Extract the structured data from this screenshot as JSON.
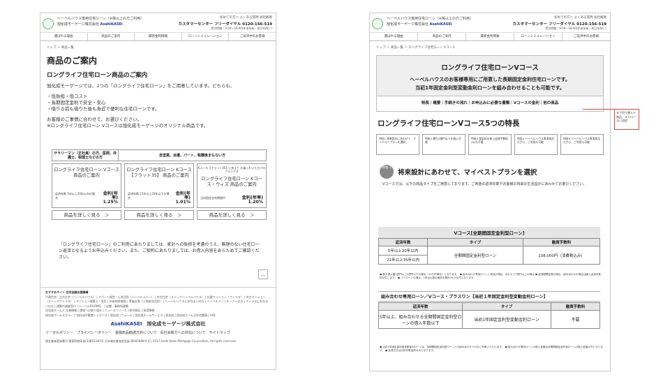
{
  "shared": {
    "org_line": "ヘーベルハウス専用住宅ローン（※株以上の方ご利用）",
    "company_name": "旭化成モーゲージ株式会社",
    "brand": "AsahiKASEI",
    "links": "初めての方へ  よくある質問    会社概要",
    "customer_center": "カスタマーセンター  フリーダイヤル 0120-156-519",
    "hours": "受付時間：9:00～18:00(年末年始・祝日を除く)"
  },
  "pageA": {
    "nav": [
      "選ばれる理由",
      "商品のご案内",
      "最新金利情報",
      "ローンシミュレーション",
      "ご返済中のお客様"
    ],
    "breadcrumb": "トップ ＞ 商品一覧",
    "title": "商品のご案内",
    "subtitle": "ロングライフ住宅ローン商品のご案内",
    "intro": "旭化成モーゲージでは、2つの「ロングライフ住宅ローン」をご用意しています。どちらも、",
    "bullets": [
      "・低負担・低コスト",
      "・長期固定金利で安全・安心",
      "・借りる前も借りた後も身近で便利な住宅ローンです。"
    ],
    "intro2": "お客様のご事情に合わせて、お選びください。",
    "intro3": "※ロングライフ住宅ローン Vコースは旭化成モーゲージのオリジナル商品です。",
    "segments": [
      "サラリーマン（正社員）の方、医師、弁護士、税理士などの方",
      "自営業、派遣、パート、転職後まもない方"
    ],
    "cards": [
      {
        "name": "ロングライフ住宅ローン Vコース 商品のご案内",
        "k_note": "",
        "term": "返済年数 5年以上20年以内の場合",
        "label": "金利(年率)",
        "rate": "1.25%"
      },
      {
        "name": "ロングライフ住宅ローン Kコース 【フラット35】 商品のご案内",
        "k_note": "",
        "term": "返済年数 15年以上20年以下の場合",
        "label": "金利(年率)",
        "rate": "1.01%"
      },
      {
        "name": "ロングライフ住宅ローン Kコース・ウィズ 商品のご案内",
        "k_note": "Kコース【フラット35】に加えて お乗入れいただけるプランです",
        "term": "当初固定金利期間中",
        "label": "金利(年率)",
        "rate": "1.20%"
      }
    ],
    "detail_label": "商品を詳しく見る　＞",
    "note": "「ロングライフ住宅ローン」のご利用にあたりましては、家計への負担を考慮のうえ、無理のない住宅ローン返済となるようお申込みください。また、ご契約にあたりましては、お借入内容をあらためてご確認ください。",
    "totop": "︿",
    "footer": {
      "related": "おすすめサイト  住宅金融支援機構",
      "links1": "戸建住宅：注文住宅（ヘーベルハウス） | アパート経営・土地活用（ヘーベルメゾン） | 中古住宅（ストックヘーベルハウス） | 分譲マンション（アトラス） | 中古マンション（ストックアトラス） | マンション建替え・再生 | 市街地再開発 | 等価交換（土地有効活用） | ヘーベルハウスにお住まいの方 | ヘーベルメゾンオーナーの方 | アトラスにお住まいの方 | 建築の調査窓口（ヘーベルROOMS） | 店舗・事務所建築",
      "links2": "住化成ホームズ   企業情報 | 環境への取り組み | ニュースリリース | 研究報告 | 採用情報",
      "links3": "旭化成ホームズグループ   旭化成不動産レジデンス | 旭化成リフォーム | 旭化成ホームサービス | 旭化成 | 旭化成ホームズ住宅関連 | AXE",
      "brand_sub": "旭化成モーゲージ株式会社",
      "policies": "リーガルポリシー　プライバシーポリシー　金融商品勧誘方針について　反社会勢力への対応について　サイトマップ",
      "copyright": "貸金業者登録番号 関東財務局長(3)第01362号 日本貸金業協会会員 第005888号 (C) 2017 Asahi Kasei Mortgage Corporation. All rights reserved."
    }
  },
  "pageB": {
    "nav": [
      "選ばれる理由",
      "商品のご案内",
      "最新金利情報",
      "ローンシミュレーション",
      "ご返済中のお客様"
    ],
    "breadcrumb": "トップ ＞ 商品一覧 ＞ ロングライフ住宅ローン Vコース",
    "hero_title": "ロングライフ住宅ローンVコース",
    "hero_sub1": "ヘーベルハウスのお客様専用にご用意した長期固定金利住宅ローンです。",
    "hero_sub2": "当初1年固定金利型変動金利ローンを組み合わせることも可能です。",
    "tabs": "特長｜概要｜手続きの流れ｜お申込みに必要な書類｜Vコースの金利｜他の商品",
    "section_title": "ロングライフ住宅ローンVコース5つの特長",
    "steps": [
      "特長1 将来設計にあわせて、マイベストプランを選択",
      "特長2 最大3億円までお借入可能",
      "特長3 保証料を無上返済手数料(※)も不要",
      "特長4 ヘーベルハウス専用商品だから、ご利用も可能",
      "特長5 ヘーベルハウス専用商品だから、ご利用も可能"
    ],
    "feature_badge": "特長 1",
    "feature_title": "将来設計にあわせて、マイベストプランを選択",
    "feature_body": "Vコースでは、以下の商品タイプをご用意しております。ご希望の返済年数やお客様の将来の生活設計にあわせてお選びください。",
    "table1_title": "Vコース[全期間固定金利型ローン]",
    "table1_headers": [
      "返済年数",
      "タイプ",
      "融資手数料"
    ],
    "table1_rows": [
      "5年以上20年以内",
      "21年以上35年以内"
    ],
    "table1_type": "全期間固定金利型ローン",
    "table1_fee": "108,000円（消費税込み）",
    "table1_notes": "● 最大借入額1億円以上5億円以下の場合（10万円単位）となります。 ● 組み合わせ専用ローンと商品の場合、合わせて1億円以上の場合 ● 返済期間延長の場合、組み合わせの場合は繰上返済手数料が生じます。 ● ペアローンの場合、2本目以降の融資手数料54,000円となります。",
    "bar2": "組み合わせ専用ローン／Vコース・プラスワン【当初１年固定金利型変動金利ローン】",
    "table2_headers": [
      "返済年数",
      "タイプ",
      "融資手数料"
    ],
    "table2_term": "5年以上、組み合わせる全期間固定金利型ローンの借入年数以下",
    "table2_type": "当初1年固定金利型変動金利ローン",
    "table2_fee": "不要",
    "table2_notes": "● 当初1年固定金利型変動金利ローンは、全期間固定金利型ローンとの組み合わせでのみご利用いただけます。 ● 組み合わせ専用ローンの借入金額は全期間固定金利型ローンの借入金額以内となります。 ● 返済方法は元利均等返済のみとなります。"
  },
  "annotation": "タブ切り替えで商品、スクロールに追従"
}
